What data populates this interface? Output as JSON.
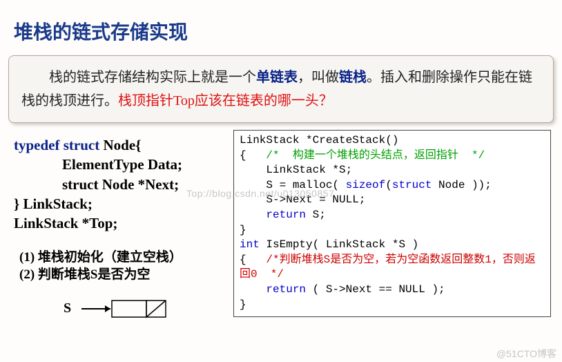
{
  "title": "堆栈的链式存储实现",
  "intro": {
    "pre": "栈的链式存储结构实际上就是一个",
    "term1": "单链表",
    "mid1": "，叫做",
    "term2": "链栈",
    "mid2": "。插入和删除操作只能在链栈的栈顶进行。",
    "question": "栈顶指针Top应该在链表的哪一头？"
  },
  "typedef": {
    "kw1": "typedef",
    "kw2": "struct",
    "name": " Node{",
    "l2": "ElementType  Data;",
    "l3": "struct Node *Next;",
    "l4": "} LinkStack;",
    "l5": "LinkStack *Top;"
  },
  "ops": {
    "o1": "(1) 堆栈初始化（建立空栈）",
    "o2": "(2) 判断堆栈S是否为空"
  },
  "diagram_label": "S",
  "code": {
    "l1": "LinkStack *CreateStack()",
    "l2a": "{   ",
    "l2c": "/*  构建一个堆栈的头结点，返回指针  */",
    "l3": "    LinkStack *S;",
    "l4a": "    S = malloc( ",
    "l4b": "sizeof",
    "l4c": "(",
    "l4d": "struct",
    "l4e": " Node ));",
    "l5": "    S->Next = NULL;",
    "l6a": "    ",
    "l6b": "return",
    "l6c": " S;",
    "l7": "}",
    "l8a": "int",
    "l8b": " IsEmpty( LinkStack *S )",
    "l9a": "{   ",
    "l9c": "/*判断堆栈S是否为空，若为空函数返回整数1，否则返回0  */",
    "l10a": "    ",
    "l10b": "return",
    "l10c": " ( S->Next == NULL );",
    "l11": "}"
  },
  "watermark1": "Top://blog.csdn.net/u013050857",
  "watermark2": "@51CTO博客"
}
